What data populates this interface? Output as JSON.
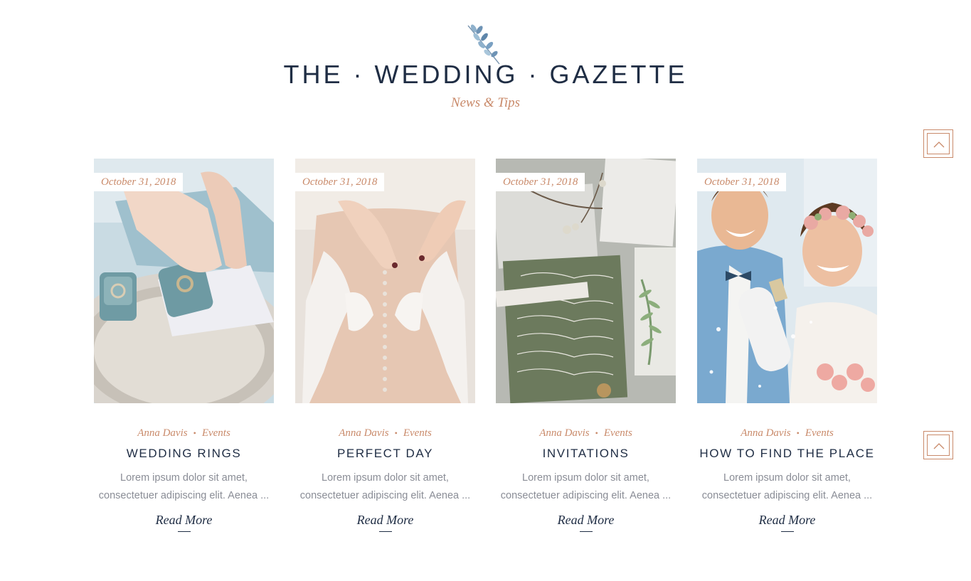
{
  "header": {
    "title": "THE · WEDDING · GAZETTE",
    "subtitle": "News & Tips",
    "logo_icon": "eucalyptus-leaf-icon"
  },
  "colors": {
    "accent": "#c98a6a",
    "heading": "#1f2d44",
    "body_text": "#8a8d96"
  },
  "posts": [
    {
      "date": "October 31, 2018",
      "author": "Anna Davis",
      "category": "Events",
      "title": "WEDDING RINGS",
      "excerpt_line1": "Lorem ipsum dolor sit amet,",
      "excerpt_line2": "consectetuer adipiscing elit. Aenea ...",
      "read_more": "Read More",
      "image": "wedding-rings-photo"
    },
    {
      "date": "October 31, 2018",
      "author": "Anna Davis",
      "category": "Events",
      "title": "PERFECT DAY",
      "excerpt_line1": "Lorem ipsum dolor sit amet,",
      "excerpt_line2": "consectetuer adipiscing elit. Aenea ...",
      "read_more": "Read More",
      "image": "lace-dress-photo"
    },
    {
      "date": "October 31, 2018",
      "author": "Anna Davis",
      "category": "Events",
      "title": "INVITATIONS",
      "excerpt_line1": "Lorem ipsum dolor sit amet,",
      "excerpt_line2": "consectetuer adipiscing elit. Aenea ...",
      "read_more": "Read More",
      "image": "invitations-photo"
    },
    {
      "date": "October 31, 2018",
      "author": "Anna Davis",
      "category": "Events",
      "title": "HOW TO FIND THE PLACE",
      "excerpt_line1": "Lorem ipsum dolor sit amet,",
      "excerpt_line2": "consectetuer adipiscing elit. Aenea ...",
      "read_more": "Read More",
      "image": "couple-celebration-photo"
    }
  ],
  "scroll_buttons": {
    "icon": "chevron-up-icon"
  }
}
